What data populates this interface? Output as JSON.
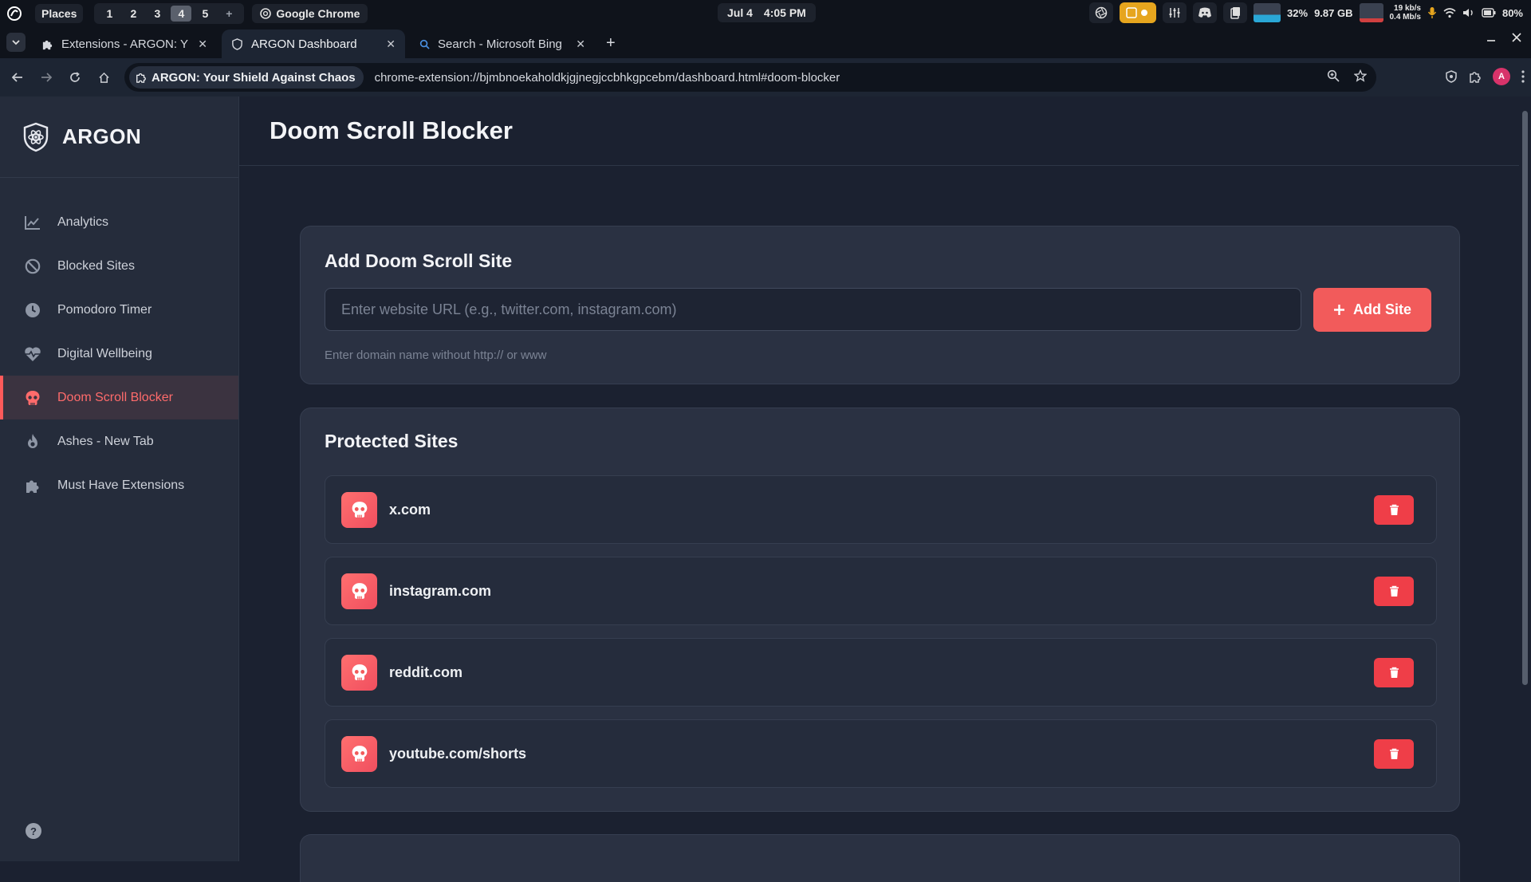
{
  "os": {
    "places": "Places",
    "workspaces": [
      "1",
      "2",
      "3",
      "4",
      "5",
      "+"
    ],
    "active_workspace": "4",
    "app": "Google Chrome",
    "date": "Jul 4",
    "time": "4:05 PM",
    "cpu": "32%",
    "memory": "9.87 GB",
    "net_up": "19 kb/s",
    "net_down": "0.4 Mb/s",
    "battery": "80%"
  },
  "browser": {
    "tabs": [
      {
        "title": "Extensions - ARGON: Y",
        "active": false
      },
      {
        "title": "ARGON Dashboard",
        "active": true
      },
      {
        "title": "Search - Microsoft Bing",
        "active": false
      }
    ],
    "origin_chip": "ARGON: Your Shield Against Chaos",
    "url": "chrome-extension://bjmbnoekaholdkjgjnegjccbhkgpcebm/dashboard.html#doom-blocker",
    "profile_initial": "A"
  },
  "sidebar": {
    "brand": "ARGON",
    "items": [
      {
        "label": "Analytics",
        "icon": "chart-line-icon",
        "active": false
      },
      {
        "label": "Blocked Sites",
        "icon": "ban-icon",
        "active": false
      },
      {
        "label": "Pomodoro Timer",
        "icon": "clock-icon",
        "active": false
      },
      {
        "label": "Digital Wellbeing",
        "icon": "heart-pulse-icon",
        "active": false
      },
      {
        "label": "Doom Scroll Blocker",
        "icon": "skull-icon",
        "active": true
      },
      {
        "label": "Ashes - New Tab",
        "icon": "fire-icon",
        "active": false
      },
      {
        "label": "Must Have Extensions",
        "icon": "puzzle-icon",
        "active": false
      }
    ],
    "help": "?"
  },
  "main": {
    "title": "Doom Scroll Blocker",
    "add_card": {
      "title": "Add Doom Scroll Site",
      "placeholder": "Enter website URL (e.g., twitter.com, instagram.com)",
      "button": "Add Site",
      "hint": "Enter domain name without http:// or www"
    },
    "protected": {
      "title": "Protected Sites",
      "sites": [
        "x.com",
        "instagram.com",
        "reddit.com",
        "youtube.com/shorts"
      ]
    }
  },
  "colors": {
    "accent": "#f25b5b",
    "delete": "#ef3e48",
    "sidebar_bg": "#252c3b",
    "card_bg": "#2a3142"
  }
}
